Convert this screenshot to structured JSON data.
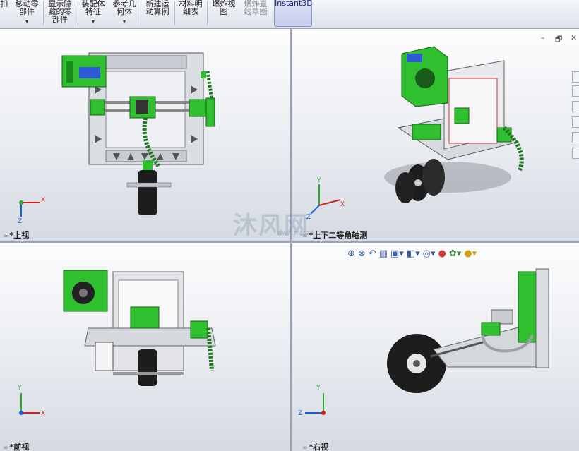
{
  "toolbar": {
    "buttons": [
      {
        "label": "扣",
        "arrow": ""
      },
      {
        "label": "移动零\n部件",
        "arrow": "▾"
      },
      {
        "label": "显示隐\n藏的零\n部件",
        "arrow": ""
      },
      {
        "label": "装配体\n特征",
        "arrow": "▾"
      },
      {
        "label": "参考几\n何体",
        "arrow": "▾"
      },
      {
        "label": "新建运\n动算例",
        "arrow": ""
      },
      {
        "label": "材料明\n细表",
        "arrow": ""
      },
      {
        "label": "爆炸视\n图",
        "arrow": ""
      },
      {
        "label": "爆炸直\n线草图",
        "arrow": ""
      },
      {
        "label": "Instant3D",
        "arrow": ""
      }
    ]
  },
  "tab_stub": "5",
  "window_controls": {
    "minimize": "–",
    "restore": "🗗",
    "close": "✕"
  },
  "viewports": {
    "top": {
      "label": "*上视"
    },
    "iso": {
      "label": "*上下二等角轴测"
    },
    "front": {
      "label": "*前视"
    },
    "right": {
      "label": "*右视"
    }
  },
  "axes": {
    "x": "X",
    "y": "Y",
    "z": "Z"
  },
  "hud_icons": [
    "zoom-to-fit-icon",
    "zoom-area-icon",
    "previous-view-icon",
    "section-view-icon",
    "view-orientation-icon",
    "display-style-icon",
    "hide-show-icon",
    "edit-appearance-icon",
    "apply-scene-icon",
    "view-settings-icon"
  ],
  "watermark": {
    "text": "沐风网",
    "url": "www.mfcad.com"
  },
  "colors": {
    "green": "#2fbf2f",
    "darkgreen": "#157a15",
    "frame": "#cfd3d8",
    "blue_lcd": "#2d5bd8"
  }
}
